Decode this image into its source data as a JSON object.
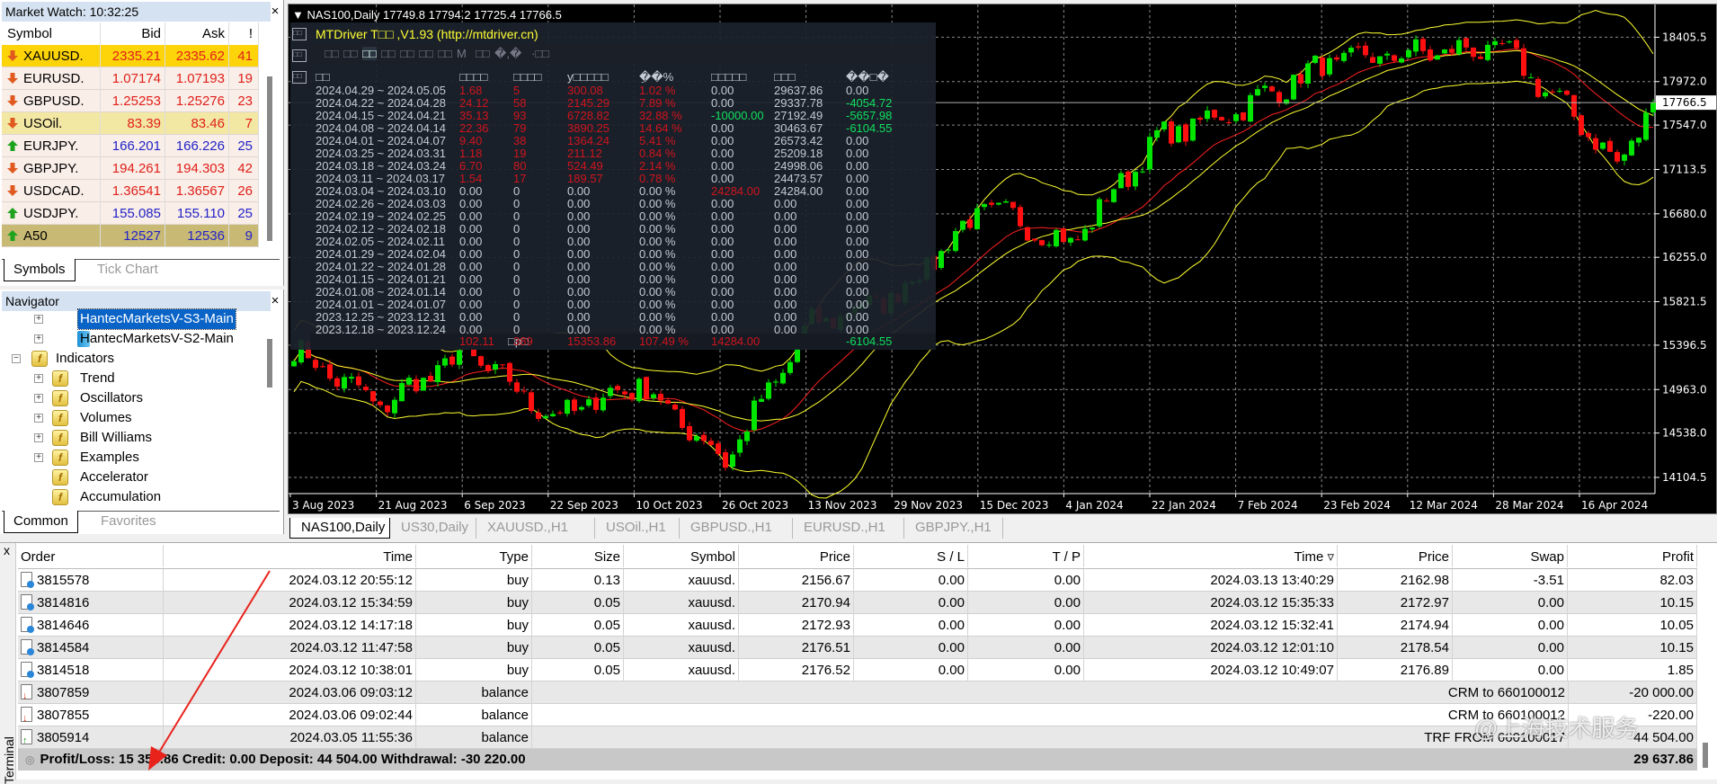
{
  "market_watch": {
    "title": "Market Watch: 10:32:25",
    "close": "×",
    "headers": [
      "Symbol",
      "Bid",
      "Ask",
      "!"
    ],
    "rows": [
      {
        "symbol": "XAUUSD.",
        "bid": "2335.21",
        "ask": "2335.62",
        "spread": "41",
        "dir": "down",
        "bg": "#fdd30a"
      },
      {
        "symbol": "EURUSD.",
        "bid": "1.07174",
        "ask": "1.07193",
        "spread": "19",
        "dir": "down",
        "bg": "#f9eee8"
      },
      {
        "symbol": "GBPUSD.",
        "bid": "1.25253",
        "ask": "1.25276",
        "spread": "23",
        "dir": "down",
        "bg": "#f9eee8"
      },
      {
        "symbol": "USOil.",
        "bid": "83.39",
        "ask": "83.46",
        "spread": "7",
        "dir": "down",
        "bg": "#f3e7a4"
      },
      {
        "symbol": "EURJPY.",
        "bid": "166.201",
        "ask": "166.226",
        "spread": "25",
        "dir": "up",
        "bg": "#f9eee8"
      },
      {
        "symbol": "GBPJPY.",
        "bid": "194.261",
        "ask": "194.303",
        "spread": "42",
        "dir": "down",
        "bg": "#f9eee8"
      },
      {
        "symbol": "USDCAD.",
        "bid": "1.36541",
        "ask": "1.36567",
        "spread": "26",
        "dir": "down",
        "bg": "#f9eee8"
      },
      {
        "symbol": "USDJPY.",
        "bid": "155.085",
        "ask": "155.110",
        "spread": "25",
        "dir": "up",
        "bg": "#f9eee8"
      },
      {
        "symbol": "A50",
        "bid": "12527",
        "ask": "12536",
        "spread": "9",
        "dir": "up",
        "bg": "#c8b974"
      }
    ],
    "tabs": [
      "Symbols",
      "Tick Chart"
    ]
  },
  "navigator": {
    "title": "Navigator",
    "close": "×",
    "items": [
      {
        "label": "HantecMarketsV-S3-Main",
        "level": 2,
        "icon": "server",
        "expander": "+",
        "selected": true
      },
      {
        "label": "HantecMarketsV-S2-Main",
        "level": 2,
        "icon": "server",
        "expander": "+"
      },
      {
        "label": "Indicators",
        "level": 1,
        "icon": "indicator",
        "expander": "−"
      },
      {
        "label": "Trend",
        "level": 2,
        "icon": "indicator",
        "expander": "+"
      },
      {
        "label": "Oscillators",
        "level": 2,
        "icon": "indicator",
        "expander": "+"
      },
      {
        "label": "Volumes",
        "level": 2,
        "icon": "indicator",
        "expander": "+"
      },
      {
        "label": "Bill Williams",
        "level": 2,
        "icon": "indicator",
        "expander": "+"
      },
      {
        "label": "Examples",
        "level": 2,
        "icon": "custom-indicator",
        "expander": "+"
      },
      {
        "label": "Accelerator",
        "level": 2,
        "icon": "custom-indicator"
      },
      {
        "label": "Accumulation",
        "level": 2,
        "icon": "custom-indicator"
      }
    ],
    "tabs": [
      "Common",
      "Favorites"
    ]
  },
  "chart": {
    "info": "▼ NAS100,Daily  17749.8 17794.2 17725.4 17766.5",
    "current_price": "17766.5",
    "price_ticks": [
      "18405.5",
      "17972.0",
      "17547.0",
      "17113.5",
      "16680.0",
      "16255.0",
      "15821.5",
      "15396.5",
      "14963.0",
      "14538.0",
      "14104.5"
    ],
    "date_ticks": [
      "3 Aug 2023",
      "21 Aug 2023",
      "6 Sep 2023",
      "22 Sep 2023",
      "10 Oct 2023",
      "26 Oct 2023",
      "13 Nov 2023",
      "29 Nov 2023",
      "15 Dec 2023",
      "4 Jan 2024",
      "22 Jan 2024",
      "7 Feb 2024",
      "23 Feb 2024",
      "12 Mar 2024",
      "28 Mar 2024",
      "16 Apr 2024"
    ],
    "price_path": [
      15350,
      14800,
      15330,
      14690,
      15020,
      14270,
      15600,
      15900,
      16750,
      16380,
      17410,
      17725,
      18160,
      18250,
      18290,
      17500
    ],
    "price_path_tail": [
      17130,
      17766.5
    ],
    "colors": {
      "bull": "#00e600",
      "bear": "#ff1010",
      "ma": "#ff2020",
      "bands": "#ffff30",
      "grid": "#8a8a8a"
    }
  },
  "mtdriver": {
    "title": "MTDriver T□□ ,V1.93 (http://mtdriver.cn)",
    "toolbar": [
      "□□",
      "□□",
      "□□",
      "□□",
      "□□",
      "□□",
      "□□",
      "M",
      "□□",
      "�,�",
      "·□□"
    ],
    "side_icons": [
      "□□",
      "□□",
      "□□"
    ],
    "headers": [
      "□□",
      "□□□□",
      "□□□□",
      "y□□□□□",
      "�ֵ�%",
      "□□□□□",
      "□□□",
      "��□�"
    ],
    "rows": [
      [
        "2024.04.29 ~ 2024.05.05",
        "1.68",
        "5",
        "300.08",
        "1.02 %",
        "0.00",
        "29637.86",
        "0.00"
      ],
      [
        "2024.04.22 ~ 2024.04.28",
        "24.12",
        "58",
        "2145.29",
        "7.89 %",
        "0.00",
        "29337.78",
        "-4054.72"
      ],
      [
        "2024.04.15 ~ 2024.04.21",
        "35.13",
        "93",
        "6728.82",
        "32.88 %",
        "-10000.00",
        "27192.49",
        "-5657.98"
      ],
      [
        "2024.04.08 ~ 2024.04.14",
        "22.36",
        "79",
        "3890.25",
        "14.64 %",
        "0.00",
        "30463.67",
        "-6104.55"
      ],
      [
        "2024.04.01 ~ 2024.04.07",
        "9.40",
        "38",
        "1364.24",
        "5.41 %",
        "0.00",
        "26573.42",
        "0.00"
      ],
      [
        "2024.03.25 ~ 2024.03.31",
        "1.18",
        "19",
        "211.12",
        "0.84 %",
        "0.00",
        "25209.18",
        "0.00"
      ],
      [
        "2024.03.18 ~ 2024.03.24",
        "6.70",
        "80",
        "524.49",
        "2.14 %",
        "0.00",
        "24998.06",
        "0.00"
      ],
      [
        "2024.03.11 ~ 2024.03.17",
        "1.54",
        "17",
        "189.57",
        "0.78 %",
        "0.00",
        "24473.57",
        "0.00"
      ],
      [
        "2024.03.04 ~ 2024.03.10",
        "0.00",
        "0",
        "0.00",
        "0.00 %",
        "24284.00",
        "24284.00",
        "0.00"
      ],
      [
        "2024.02.26 ~ 2024.03.03",
        "0.00",
        "0",
        "0.00",
        "0.00 %",
        "0.00",
        "0.00",
        "0.00"
      ],
      [
        "2024.02.19 ~ 2024.02.25",
        "0.00",
        "0",
        "0.00",
        "0.00 %",
        "0.00",
        "0.00",
        "0.00"
      ],
      [
        "2024.02.12 ~ 2024.02.18",
        "0.00",
        "0",
        "0.00",
        "0.00 %",
        "0.00",
        "0.00",
        "0.00"
      ],
      [
        "2024.02.05 ~ 2024.02.11",
        "0.00",
        "0",
        "0.00",
        "0.00 %",
        "0.00",
        "0.00",
        "0.00"
      ],
      [
        "2024.01.29 ~ 2024.02.04",
        "0.00",
        "0",
        "0.00",
        "0.00 %",
        "0.00",
        "0.00",
        "0.00"
      ],
      [
        "2024.01.22 ~ 2024.01.28",
        "0.00",
        "0",
        "0.00",
        "0.00 %",
        "0.00",
        "0.00",
        "0.00"
      ],
      [
        "2024.01.15 ~ 2024.01.21",
        "0.00",
        "0",
        "0.00",
        "0.00 %",
        "0.00",
        "0.00",
        "0.00"
      ],
      [
        "2024.01.08 ~ 2024.01.14",
        "0.00",
        "0",
        "0.00",
        "0.00 %",
        "0.00",
        "0.00",
        "0.00"
      ],
      [
        "2024.01.01 ~ 2024.01.07",
        "0.00",
        "0",
        "0.00",
        "0.00 %",
        "0.00",
        "0.00",
        "0.00"
      ],
      [
        "2023.12.25 ~ 2023.12.31",
        "0.00",
        "0",
        "0.00",
        "0.00 %",
        "0.00",
        "0.00",
        "0.00"
      ],
      [
        "2023.12.18 ~ 2023.12.24",
        "0.00",
        "0",
        "0.00",
        "0.00 %",
        "0.00",
        "0.00",
        "0.00"
      ]
    ],
    "total": [
      "□р□",
      "102.11",
      "389",
      "15353.86",
      "107.49 %",
      "14284.00",
      "",
      "-6104.55"
    ]
  },
  "chart_tabs": [
    "NAS100,Daily",
    "US30,Daily",
    "XAUUSD.,H1",
    "USOil.,H1",
    "GBPUSD.,H1",
    "EURUSD.,H1",
    "GBPJPY.,H1"
  ],
  "terminal": {
    "close": "x",
    "side_label": "Terminal",
    "headers": [
      "Order",
      "Time",
      "Type",
      "Size",
      "Symbol",
      "Price",
      "S / L",
      "T / P",
      "Time ▿",
      "Price",
      "Swap",
      "Profit"
    ],
    "rows": [
      {
        "icon": "order",
        "cells": [
          "3815578",
          "2024.03.12 20:55:12",
          "buy",
          "0.13",
          "xauusd.",
          "2156.67",
          "0.00",
          "0.00",
          "2024.03.13 13:40:29",
          "2162.98",
          "-3.51",
          "82.03"
        ]
      },
      {
        "icon": "order",
        "cells": [
          "3814816",
          "2024.03.12 15:34:59",
          "buy",
          "0.05",
          "xauusd.",
          "2170.94",
          "0.00",
          "0.00",
          "2024.03.12 15:35:33",
          "2172.97",
          "0.00",
          "10.15"
        ]
      },
      {
        "icon": "order",
        "cells": [
          "3814646",
          "2024.03.12 14:17:18",
          "buy",
          "0.05",
          "xauusd.",
          "2172.93",
          "0.00",
          "0.00",
          "2024.03.12 15:32:41",
          "2174.94",
          "0.00",
          "10.05"
        ]
      },
      {
        "icon": "order",
        "cells": [
          "3814584",
          "2024.03.12 11:47:58",
          "buy",
          "0.05",
          "xauusd.",
          "2176.51",
          "0.00",
          "0.00",
          "2024.03.12 12:01:10",
          "2178.54",
          "0.00",
          "10.15"
        ]
      },
      {
        "icon": "order",
        "cells": [
          "3814518",
          "2024.03.12 10:38:01",
          "buy",
          "0.05",
          "xauusd.",
          "2176.52",
          "0.00",
          "0.00",
          "2024.03.12 10:49:07",
          "2176.89",
          "0.00",
          "1.85"
        ]
      },
      {
        "icon": "balance-down",
        "cells": [
          "3807859",
          "2024.03.06 09:03:12",
          "balance"
        ],
        "comment": "CRM to 660100012",
        "profit": "-20 000.00"
      },
      {
        "icon": "balance-down",
        "cells": [
          "3807855",
          "2024.03.06 09:02:44",
          "balance"
        ],
        "comment": "CRM to 660100012",
        "profit": "-220.00"
      },
      {
        "icon": "balance-up",
        "cells": [
          "3805914",
          "2024.03.05 11:55:36",
          "balance"
        ],
        "comment": "TRF FROM 660100017",
        "profit": "44 504.00"
      }
    ],
    "summary": "Profit/Loss: 15 353.86  Credit: 0.00  Deposit: 44 504.00  Withdrawal: -30 220.00",
    "summary_total": "29 637.86"
  },
  "watermark": "@上海技术服务"
}
